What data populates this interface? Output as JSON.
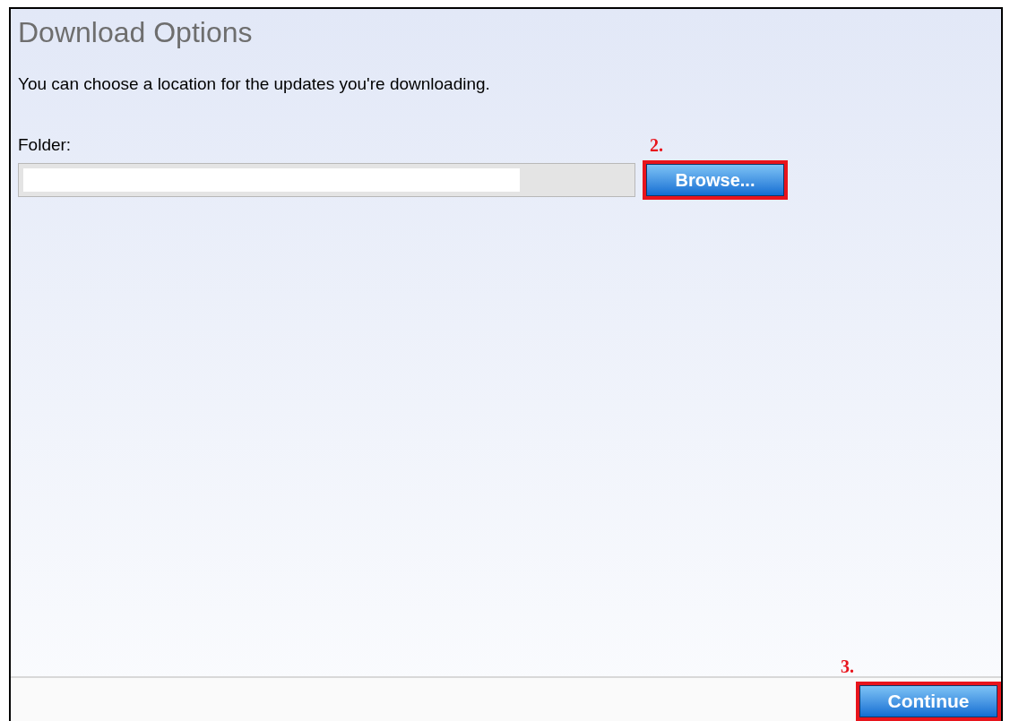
{
  "title": "Download Options",
  "description": "You can choose a location for the updates you're downloading.",
  "folder": {
    "label": "Folder:",
    "browse": {
      "label": "Browse...",
      "step": "2.",
      "highlighted": true
    }
  },
  "footer": {
    "continue": {
      "label": "Continue",
      "step": "3.",
      "highlighted": true
    }
  }
}
